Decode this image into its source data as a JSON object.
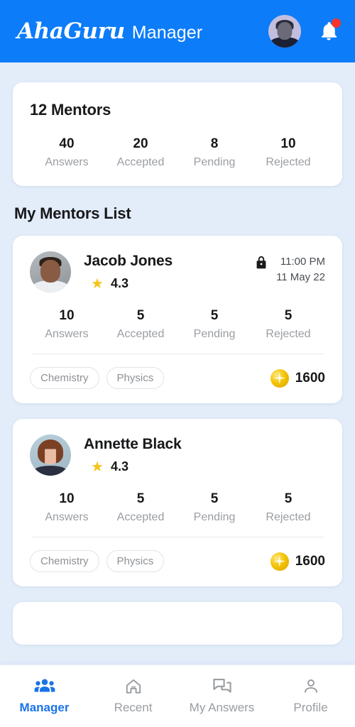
{
  "header": {
    "logo_text": "AhaGuru",
    "app_name": "Manager",
    "avatar_name": "user-avatar",
    "bell_icon": "notification-bell-icon",
    "bell_has_badge": true,
    "bg_color": "#0c7cf9"
  },
  "summary": {
    "title": "12 Mentors",
    "stats": [
      {
        "value": "40",
        "label": "Answers"
      },
      {
        "value": "20",
        "label": "Accepted"
      },
      {
        "value": "8",
        "label": "Pending"
      },
      {
        "value": "10",
        "label": "Rejected"
      }
    ]
  },
  "section": {
    "title": "My Mentors List"
  },
  "mentors": [
    {
      "name": "Jacob Jones",
      "rating": "4.3",
      "star_icon": "star-icon",
      "lock_icon": "lock-closed-icon",
      "time": "11:00 PM",
      "date": "11 May 22",
      "stats": [
        {
          "value": "10",
          "label": "Answers"
        },
        {
          "value": "5",
          "label": "Accepted"
        },
        {
          "value": "5",
          "label": "Pending"
        },
        {
          "value": "5",
          "label": "Rejected"
        }
      ],
      "tags": [
        "Chemistry",
        "Physics"
      ],
      "coin_icon": "coin-icon",
      "coins": "1600"
    },
    {
      "name": "Annette Black",
      "rating": "4.3",
      "star_icon": "star-icon",
      "lock_icon": null,
      "time": "",
      "date": "",
      "stats": [
        {
          "value": "10",
          "label": "Answers"
        },
        {
          "value": "5",
          "label": "Accepted"
        },
        {
          "value": "5",
          "label": "Pending"
        },
        {
          "value": "5",
          "label": "Rejected"
        }
      ],
      "tags": [
        "Chemistry",
        "Physics"
      ],
      "coin_icon": "coin-icon",
      "coins": "1600"
    }
  ],
  "bottom_nav": {
    "active_color": "#1a73e8",
    "inactive_color": "#9a9da2",
    "items": [
      {
        "label": "Manager",
        "icon": "people-group-icon",
        "active": true
      },
      {
        "label": "Recent",
        "icon": "home-icon",
        "active": false
      },
      {
        "label": "My Answers",
        "icon": "chat-bubbles-icon",
        "active": false
      },
      {
        "label": "Profile",
        "icon": "person-icon",
        "active": false
      }
    ]
  }
}
